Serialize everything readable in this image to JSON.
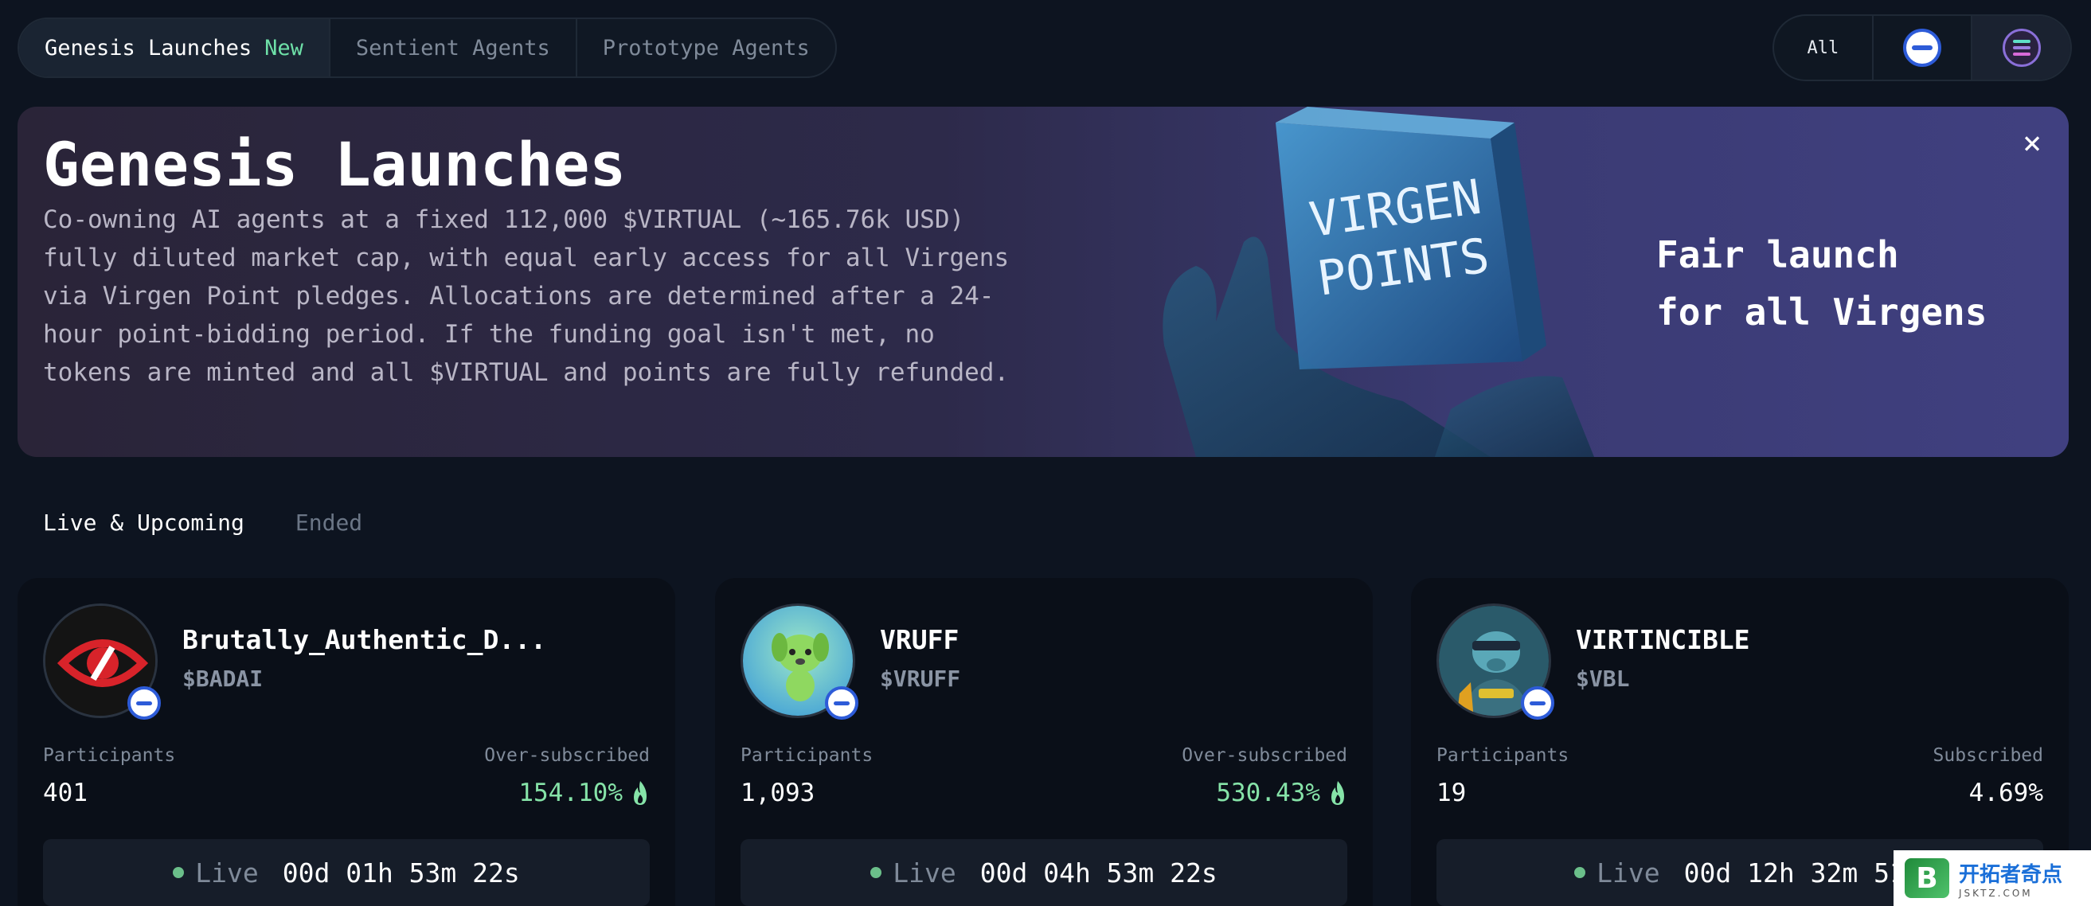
{
  "top_tabs": [
    {
      "label": "Genesis Launches",
      "badge": "New",
      "active": true
    },
    {
      "label": "Sentient Agents"
    },
    {
      "label": "Prototype Agents"
    }
  ],
  "chain_filter": {
    "all_label": "All",
    "options": [
      "base-chain-icon",
      "solana-chain-icon"
    ]
  },
  "hero": {
    "title": "Genesis Launches",
    "description": "Co-owning AI agents at a fixed 112,000 $VIRTUAL (~165.76k USD) fully diluted market cap, with equal early access for all Virgens via Virgen Point pledges. Allocations are determined after a 24-hour point-bidding period. If the funding goal isn't met, no tokens are minted and all $VIRTUAL and points are fully refunded.",
    "art_text": "VIRGEN POINTS",
    "tagline_line1": "Fair launch",
    "tagline_line2": "for all Virgens",
    "close_icon": "×"
  },
  "sub_tabs": {
    "live": "Live & Upcoming",
    "ended": "Ended"
  },
  "cards": [
    {
      "name": "Brutally_Authentic_D...",
      "ticker": "$BADAI",
      "participants_label": "Participants",
      "participants": "401",
      "subscription_label": "Over-subscribed",
      "subscription": "154.10%",
      "status": "Live",
      "countdown": "00d 01h 53m 22s"
    },
    {
      "name": "VRUFF",
      "ticker": "$VRUFF",
      "participants_label": "Participants",
      "participants": "1,093",
      "subscription_label": "Over-subscribed",
      "subscription": "530.43%",
      "status": "Live",
      "countdown": "00d 04h 53m 22s"
    },
    {
      "name": "VIRTINCIBLE",
      "ticker": "$VBL",
      "participants_label": "Participants",
      "participants": "19",
      "subscription_label": "Subscribed",
      "subscription": "4.69%",
      "status": "Live",
      "countdown": "00d 12h 32m 51"
    }
  ],
  "watermark": {
    "logo": "B",
    "cn": "开拓者奇点",
    "en": "JSKTZ.COM"
  },
  "colors": {
    "accent_green": "#86e3a8",
    "base_blue": "#2d5bd8",
    "background": "#0d1420"
  }
}
